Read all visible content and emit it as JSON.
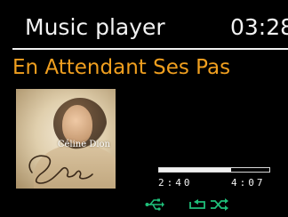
{
  "header": {
    "title": "Music player",
    "clock": "03:28"
  },
  "track": {
    "title": "En Attendant Ses Pas"
  },
  "album_art": {
    "text": "Céline Dion",
    "signature": "Céline",
    "icon": "album-cover-photo"
  },
  "playback": {
    "elapsed": "2:40",
    "total": "4:07",
    "progress_percent": 65
  },
  "status_icons": [
    "usb-icon",
    "repeat-icon",
    "shuffle-icon"
  ],
  "colors": {
    "background": "#000000",
    "track_title": "#f09f1f",
    "text": "#f2f2f2",
    "status_icons": "#1fbf7a"
  }
}
